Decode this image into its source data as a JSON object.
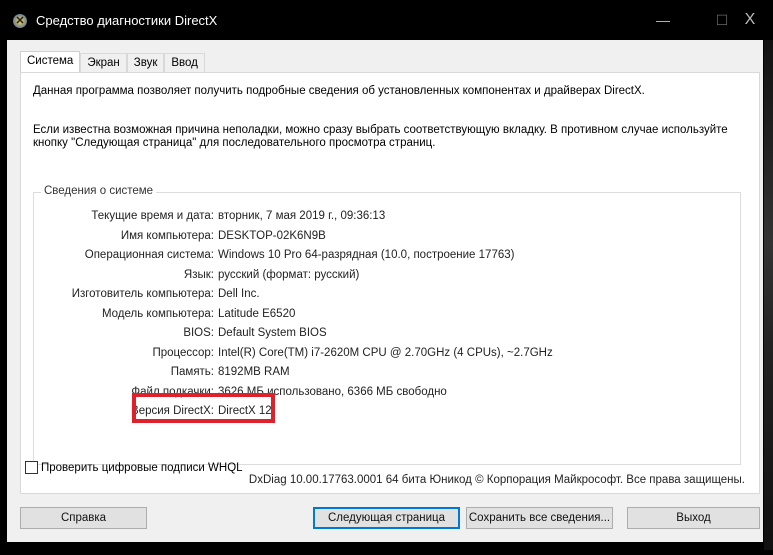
{
  "window": {
    "title": "Средство диагностики DirectX",
    "minimize": "—",
    "maximize": "☐",
    "close": "X"
  },
  "tabs": [
    "Система",
    "Экран",
    "Звук",
    "Ввод"
  ],
  "intro": [
    "Данная программа позволяет получить подробные сведения об установленных компонентах и драйверах DirectX.",
    "Если известна возможная причина неполадки, можно сразу выбрать соответствующую вкладку. В противном случае используйте",
    "кнопку \"Следующая страница\" для последовательного просмотра страниц."
  ],
  "system_info": {
    "legend": "Сведения о системе",
    "rows": [
      {
        "label": "Текущие время и дата:",
        "value": "вторник, 7 мая 2019 г., 09:36:13"
      },
      {
        "label": "Имя компьютера:",
        "value": "DESKTOP-02K6N9B"
      },
      {
        "label": "Операционная система:",
        "value": "Windows 10 Pro 64-разрядная (10.0, построение 17763)"
      },
      {
        "label": "Язык:",
        "value": "русский (формат: русский)"
      },
      {
        "label": "Изготовитель компьютера:",
        "value": "Dell Inc."
      },
      {
        "label": "Модель компьютера:",
        "value": "Latitude E6520"
      },
      {
        "label": "BIOS:",
        "value": "Default System BIOS"
      },
      {
        "label": "Процессор:",
        "value": "Intel(R) Core(TM) i7-2620M CPU @ 2.70GHz (4 CPUs), ~2.7GHz"
      },
      {
        "label": "Память:",
        "value": "8192MB RAM"
      },
      {
        "label": "Файл подкачки:",
        "value": "3626 МБ использовано, 6366 МБ свободно"
      },
      {
        "label": "Версия DirectX:",
        "value": "DirectX 12"
      }
    ]
  },
  "whql_checkbox": {
    "label": "Проверить цифровые подписи WHQL",
    "checked": false
  },
  "footer": "DxDiag 10.00.17763.0001 64 бита Юникод  © Корпорация Майкрософт. Все права защищены.",
  "buttons": {
    "help": "Справка",
    "next": "Следующая страница",
    "save": "Сохранить все сведения...",
    "exit": "Выход"
  },
  "highlight_color": "#e0202a"
}
